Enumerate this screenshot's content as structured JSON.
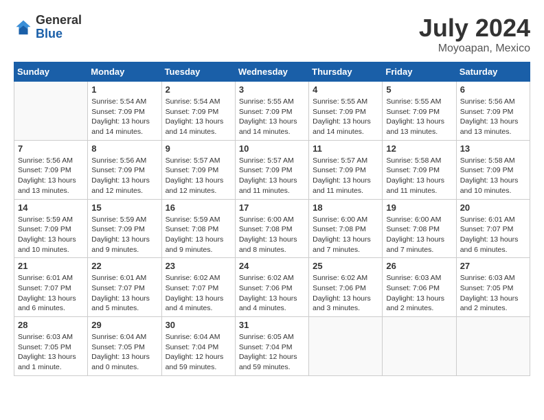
{
  "logo": {
    "general": "General",
    "blue": "Blue"
  },
  "title": {
    "month_year": "July 2024",
    "location": "Moyoapan, Mexico"
  },
  "weekdays": [
    "Sunday",
    "Monday",
    "Tuesday",
    "Wednesday",
    "Thursday",
    "Friday",
    "Saturday"
  ],
  "weeks": [
    [
      {
        "day": "",
        "sunrise": "",
        "sunset": "",
        "daylight": ""
      },
      {
        "day": "1",
        "sunrise": "Sunrise: 5:54 AM",
        "sunset": "Sunset: 7:09 PM",
        "daylight": "Daylight: 13 hours and 14 minutes."
      },
      {
        "day": "2",
        "sunrise": "Sunrise: 5:54 AM",
        "sunset": "Sunset: 7:09 PM",
        "daylight": "Daylight: 13 hours and 14 minutes."
      },
      {
        "day": "3",
        "sunrise": "Sunrise: 5:55 AM",
        "sunset": "Sunset: 7:09 PM",
        "daylight": "Daylight: 13 hours and 14 minutes."
      },
      {
        "day": "4",
        "sunrise": "Sunrise: 5:55 AM",
        "sunset": "Sunset: 7:09 PM",
        "daylight": "Daylight: 13 hours and 14 minutes."
      },
      {
        "day": "5",
        "sunrise": "Sunrise: 5:55 AM",
        "sunset": "Sunset: 7:09 PM",
        "daylight": "Daylight: 13 hours and 13 minutes."
      },
      {
        "day": "6",
        "sunrise": "Sunrise: 5:56 AM",
        "sunset": "Sunset: 7:09 PM",
        "daylight": "Daylight: 13 hours and 13 minutes."
      }
    ],
    [
      {
        "day": "7",
        "sunrise": "Sunrise: 5:56 AM",
        "sunset": "Sunset: 7:09 PM",
        "daylight": "Daylight: 13 hours and 13 minutes."
      },
      {
        "day": "8",
        "sunrise": "Sunrise: 5:56 AM",
        "sunset": "Sunset: 7:09 PM",
        "daylight": "Daylight: 13 hours and 12 minutes."
      },
      {
        "day": "9",
        "sunrise": "Sunrise: 5:57 AM",
        "sunset": "Sunset: 7:09 PM",
        "daylight": "Daylight: 13 hours and 12 minutes."
      },
      {
        "day": "10",
        "sunrise": "Sunrise: 5:57 AM",
        "sunset": "Sunset: 7:09 PM",
        "daylight": "Daylight: 13 hours and 11 minutes."
      },
      {
        "day": "11",
        "sunrise": "Sunrise: 5:57 AM",
        "sunset": "Sunset: 7:09 PM",
        "daylight": "Daylight: 13 hours and 11 minutes."
      },
      {
        "day": "12",
        "sunrise": "Sunrise: 5:58 AM",
        "sunset": "Sunset: 7:09 PM",
        "daylight": "Daylight: 13 hours and 11 minutes."
      },
      {
        "day": "13",
        "sunrise": "Sunrise: 5:58 AM",
        "sunset": "Sunset: 7:09 PM",
        "daylight": "Daylight: 13 hours and 10 minutes."
      }
    ],
    [
      {
        "day": "14",
        "sunrise": "Sunrise: 5:59 AM",
        "sunset": "Sunset: 7:09 PM",
        "daylight": "Daylight: 13 hours and 10 minutes."
      },
      {
        "day": "15",
        "sunrise": "Sunrise: 5:59 AM",
        "sunset": "Sunset: 7:09 PM",
        "daylight": "Daylight: 13 hours and 9 minutes."
      },
      {
        "day": "16",
        "sunrise": "Sunrise: 5:59 AM",
        "sunset": "Sunset: 7:08 PM",
        "daylight": "Daylight: 13 hours and 9 minutes."
      },
      {
        "day": "17",
        "sunrise": "Sunrise: 6:00 AM",
        "sunset": "Sunset: 7:08 PM",
        "daylight": "Daylight: 13 hours and 8 minutes."
      },
      {
        "day": "18",
        "sunrise": "Sunrise: 6:00 AM",
        "sunset": "Sunset: 7:08 PM",
        "daylight": "Daylight: 13 hours and 7 minutes."
      },
      {
        "day": "19",
        "sunrise": "Sunrise: 6:00 AM",
        "sunset": "Sunset: 7:08 PM",
        "daylight": "Daylight: 13 hours and 7 minutes."
      },
      {
        "day": "20",
        "sunrise": "Sunrise: 6:01 AM",
        "sunset": "Sunset: 7:07 PM",
        "daylight": "Daylight: 13 hours and 6 minutes."
      }
    ],
    [
      {
        "day": "21",
        "sunrise": "Sunrise: 6:01 AM",
        "sunset": "Sunset: 7:07 PM",
        "daylight": "Daylight: 13 hours and 6 minutes."
      },
      {
        "day": "22",
        "sunrise": "Sunrise: 6:01 AM",
        "sunset": "Sunset: 7:07 PM",
        "daylight": "Daylight: 13 hours and 5 minutes."
      },
      {
        "day": "23",
        "sunrise": "Sunrise: 6:02 AM",
        "sunset": "Sunset: 7:07 PM",
        "daylight": "Daylight: 13 hours and 4 minutes."
      },
      {
        "day": "24",
        "sunrise": "Sunrise: 6:02 AM",
        "sunset": "Sunset: 7:06 PM",
        "daylight": "Daylight: 13 hours and 4 minutes."
      },
      {
        "day": "25",
        "sunrise": "Sunrise: 6:02 AM",
        "sunset": "Sunset: 7:06 PM",
        "daylight": "Daylight: 13 hours and 3 minutes."
      },
      {
        "day": "26",
        "sunrise": "Sunrise: 6:03 AM",
        "sunset": "Sunset: 7:06 PM",
        "daylight": "Daylight: 13 hours and 2 minutes."
      },
      {
        "day": "27",
        "sunrise": "Sunrise: 6:03 AM",
        "sunset": "Sunset: 7:05 PM",
        "daylight": "Daylight: 13 hours and 2 minutes."
      }
    ],
    [
      {
        "day": "28",
        "sunrise": "Sunrise: 6:03 AM",
        "sunset": "Sunset: 7:05 PM",
        "daylight": "Daylight: 13 hours and 1 minute."
      },
      {
        "day": "29",
        "sunrise": "Sunrise: 6:04 AM",
        "sunset": "Sunset: 7:05 PM",
        "daylight": "Daylight: 13 hours and 0 minutes."
      },
      {
        "day": "30",
        "sunrise": "Sunrise: 6:04 AM",
        "sunset": "Sunset: 7:04 PM",
        "daylight": "Daylight: 12 hours and 59 minutes."
      },
      {
        "day": "31",
        "sunrise": "Sunrise: 6:05 AM",
        "sunset": "Sunset: 7:04 PM",
        "daylight": "Daylight: 12 hours and 59 minutes."
      },
      {
        "day": "",
        "sunrise": "",
        "sunset": "",
        "daylight": ""
      },
      {
        "day": "",
        "sunrise": "",
        "sunset": "",
        "daylight": ""
      },
      {
        "day": "",
        "sunrise": "",
        "sunset": "",
        "daylight": ""
      }
    ]
  ]
}
